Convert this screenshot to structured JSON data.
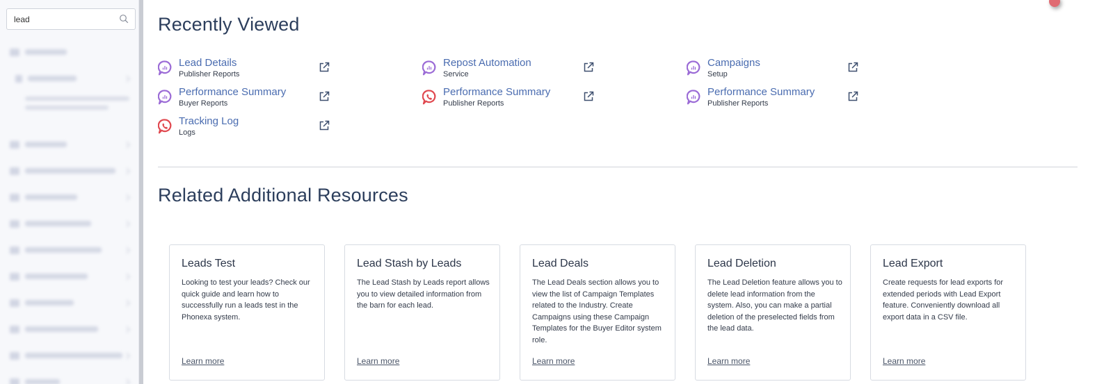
{
  "sidebar": {
    "search": {
      "value": "lead",
      "placeholder": ""
    }
  },
  "recently_viewed": {
    "title": "Recently Viewed",
    "items": [
      {
        "name": "Lead Details",
        "subtitle": "Publisher Reports",
        "icon": "purple-chat-icon"
      },
      {
        "name": "Repost Automation",
        "subtitle": "Service",
        "icon": "purple-chat-icon"
      },
      {
        "name": "Campaigns",
        "subtitle": "Setup",
        "icon": "purple-chat-icon"
      },
      {
        "name": "Performance Summary",
        "subtitle": "Buyer Reports",
        "icon": "purple-chat-icon"
      },
      {
        "name": "Performance Summary",
        "subtitle": "Publisher Reports",
        "icon": "red-phone-icon"
      },
      {
        "name": "Performance Summary",
        "subtitle": "Publisher Reports",
        "icon": "purple-chat-icon"
      },
      {
        "name": "Tracking Log",
        "subtitle": "Logs",
        "icon": "red-phone-icon"
      }
    ]
  },
  "resources": {
    "title": "Related Additional Resources",
    "cards": [
      {
        "title": "Leads Test",
        "text": "Looking to test your leads? Check our quick guide and learn how to successfully run a leads test in the Phonexa system.",
        "link": "Learn more"
      },
      {
        "title": "Lead Stash by Leads",
        "text": "The Lead Stash by Leads report allows you to view detailed information from the barn for each lead.",
        "link": "Learn more"
      },
      {
        "title": "Lead Deals",
        "text": "The Lead Deals section allows you to view the list of Campaign Templates related to the Industry. Create Campaigns using these Campaign Templates for the Buyer Editor system role.",
        "link": "Learn more"
      },
      {
        "title": "Lead Deletion",
        "text": "The Lead Deletion feature allows you to delete lead information from the system. Also, you can make a partial deletion of the preselected fields from the lead data.",
        "link": "Learn more"
      },
      {
        "title": "Lead Export",
        "text": "Create requests for lead exports for extended periods with Lead Export feature. Conveniently download all export data in a CSV file.",
        "link": "Learn more"
      }
    ]
  },
  "colors": {
    "link": "#4a6cb0",
    "purple_icon": "#9b6bd6",
    "red_icon": "#e0484f",
    "notification": "#e06b72"
  }
}
